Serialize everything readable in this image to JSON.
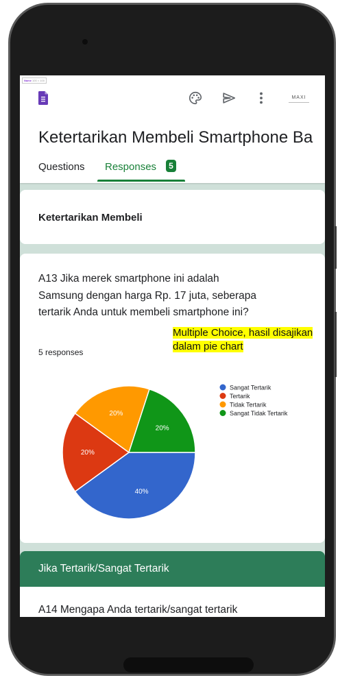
{
  "app": {
    "mini_tag_prefix": "Name",
    "mini_tag_text": "100 × 100",
    "avatar_text": "MAXI",
    "form_title": "Ketertarikan Membeli Smartphone Ba"
  },
  "tabs": [
    {
      "label": "Questions",
      "active": false
    },
    {
      "label": "Responses",
      "active": true,
      "badge": "5"
    }
  ],
  "section": {
    "title": "Ketertarikan Membeli"
  },
  "question": {
    "text": "A13 Jika merek smartphone ini adalah Samsung dengan harga Rp. 17 juta, seberapa tertarik Anda untuk membeli smartphone ini?",
    "responses_label": "5 responses"
  },
  "chart_data": {
    "type": "pie",
    "slices": [
      {
        "label": "Sangat Tertarik",
        "value": 40,
        "display": "40%",
        "color": "#3366cc"
      },
      {
        "label": "Tertarik",
        "value": 20,
        "display": "20%",
        "color": "#dc3912"
      },
      {
        "label": "Tidak Tertarik",
        "value": 20,
        "display": "20%",
        "color": "#ff9900"
      },
      {
        "label": "Sangat Tidak Tertarik",
        "value": 20,
        "display": "20%",
        "color": "#109618"
      }
    ],
    "legend_position": "right"
  },
  "next_section": {
    "title": "Jika Tertarik/Sangat Tertarik"
  },
  "next_question": {
    "text": "A14 Mengapa Anda tertarik/sangat tertarik"
  },
  "annotation": {
    "line1": "Multiple Choice, hasil disajikan",
    "line2": "dalam pie chart"
  },
  "colors": {
    "accent": "#188038",
    "section_header": "#2d7d59",
    "background": "#cfe0d9"
  },
  "icons": [
    "forms-icon",
    "palette-icon",
    "send-icon",
    "more-vert-icon"
  ]
}
